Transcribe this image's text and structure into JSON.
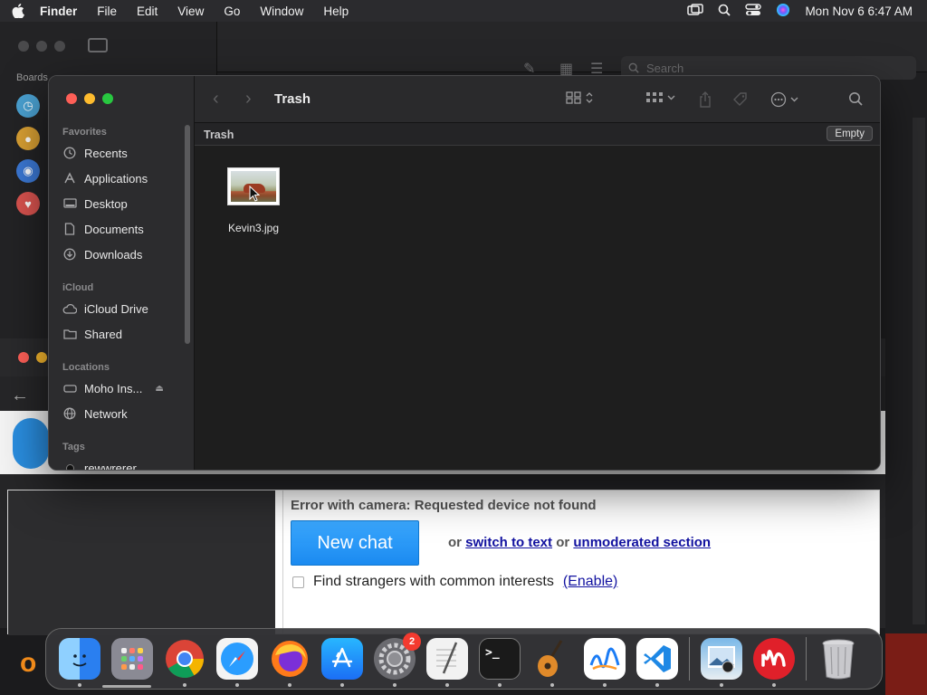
{
  "menubar": {
    "app_name": "Finder",
    "menus": [
      "File",
      "Edit",
      "View",
      "Go",
      "Window",
      "Help"
    ],
    "clock": "Mon Nov 6  6:47 AM"
  },
  "bg_window": {
    "boards_label": "Boards",
    "search_placeholder": "Search"
  },
  "finder": {
    "title": "Trash",
    "path_label": "Trash",
    "empty_button": "Empty",
    "sidebar": {
      "favorites_label": "Favorites",
      "favorites": [
        {
          "label": "Recents",
          "icon": "clock-icon"
        },
        {
          "label": "Applications",
          "icon": "applications-icon"
        },
        {
          "label": "Desktop",
          "icon": "desktop-icon"
        },
        {
          "label": "Documents",
          "icon": "document-icon"
        },
        {
          "label": "Downloads",
          "icon": "download-icon"
        }
      ],
      "icloud_label": "iCloud",
      "icloud": [
        {
          "label": "iCloud Drive",
          "icon": "cloud-icon"
        },
        {
          "label": "Shared",
          "icon": "shared-folder-icon"
        }
      ],
      "locations_label": "Locations",
      "locations": [
        {
          "label": "Moho Ins...",
          "icon": "drive-icon"
        },
        {
          "label": "Network",
          "icon": "globe-icon"
        }
      ],
      "tags_label": "Tags",
      "tags": [
        {
          "label": "rewwrerer",
          "color": "#111111"
        }
      ]
    },
    "files": [
      {
        "name": "Kevin3.jpg"
      }
    ]
  },
  "chat": {
    "error": "Error with camera: Requested device not found",
    "new_chat": "New chat",
    "or1": "or",
    "switch_text": "switch to text",
    "or2": "or",
    "unmoderated": "unmoderated section",
    "interests": "Find strangers with common interests",
    "enable": "(Enable)"
  },
  "dock": {
    "apps": [
      {
        "name": "Finder",
        "icon": "finder-icon",
        "color": "#2a7ff0",
        "running": true
      },
      {
        "name": "Launchpad",
        "icon": "launchpad-icon",
        "color": "#8a8a94",
        "running": false
      },
      {
        "name": "Google Chrome",
        "icon": "chrome-icon",
        "color": "#ffffff",
        "running": true
      },
      {
        "name": "Safari",
        "icon": "safari-icon",
        "color": "#1e90ff",
        "running": true
      },
      {
        "name": "Firefox",
        "icon": "firefox-icon",
        "color": "#ff7a1a",
        "running": true
      },
      {
        "name": "App Store",
        "icon": "app-store-icon",
        "color": "#1b7cf5",
        "running": true
      },
      {
        "name": "System Settings",
        "icon": "settings-icon",
        "color": "#6b6b70",
        "running": true,
        "badge": "2"
      },
      {
        "name": "TextEdit",
        "icon": "textedit-icon",
        "color": "#f2f2f2",
        "running": true
      },
      {
        "name": "Terminal",
        "icon": "terminal-icon",
        "color": "#1a1a1a",
        "running": true
      },
      {
        "name": "GarageBand",
        "icon": "guitar-icon",
        "color": "#e08a2a",
        "running": true
      },
      {
        "name": "Freeform",
        "icon": "freeform-icon",
        "color": "#ffffff",
        "running": true
      },
      {
        "name": "Visual Studio Code",
        "icon": "vscode-icon",
        "color": "#ffffff",
        "running": true
      }
    ],
    "recent": [
      {
        "name": "Preview",
        "icon": "preview-icon",
        "color": "#5a8ac8",
        "running": true
      },
      {
        "name": "Moho",
        "icon": "moho-icon",
        "color": "#e0202a",
        "running": true
      }
    ],
    "trash": {
      "name": "Trash",
      "icon": "trash-icon"
    }
  }
}
